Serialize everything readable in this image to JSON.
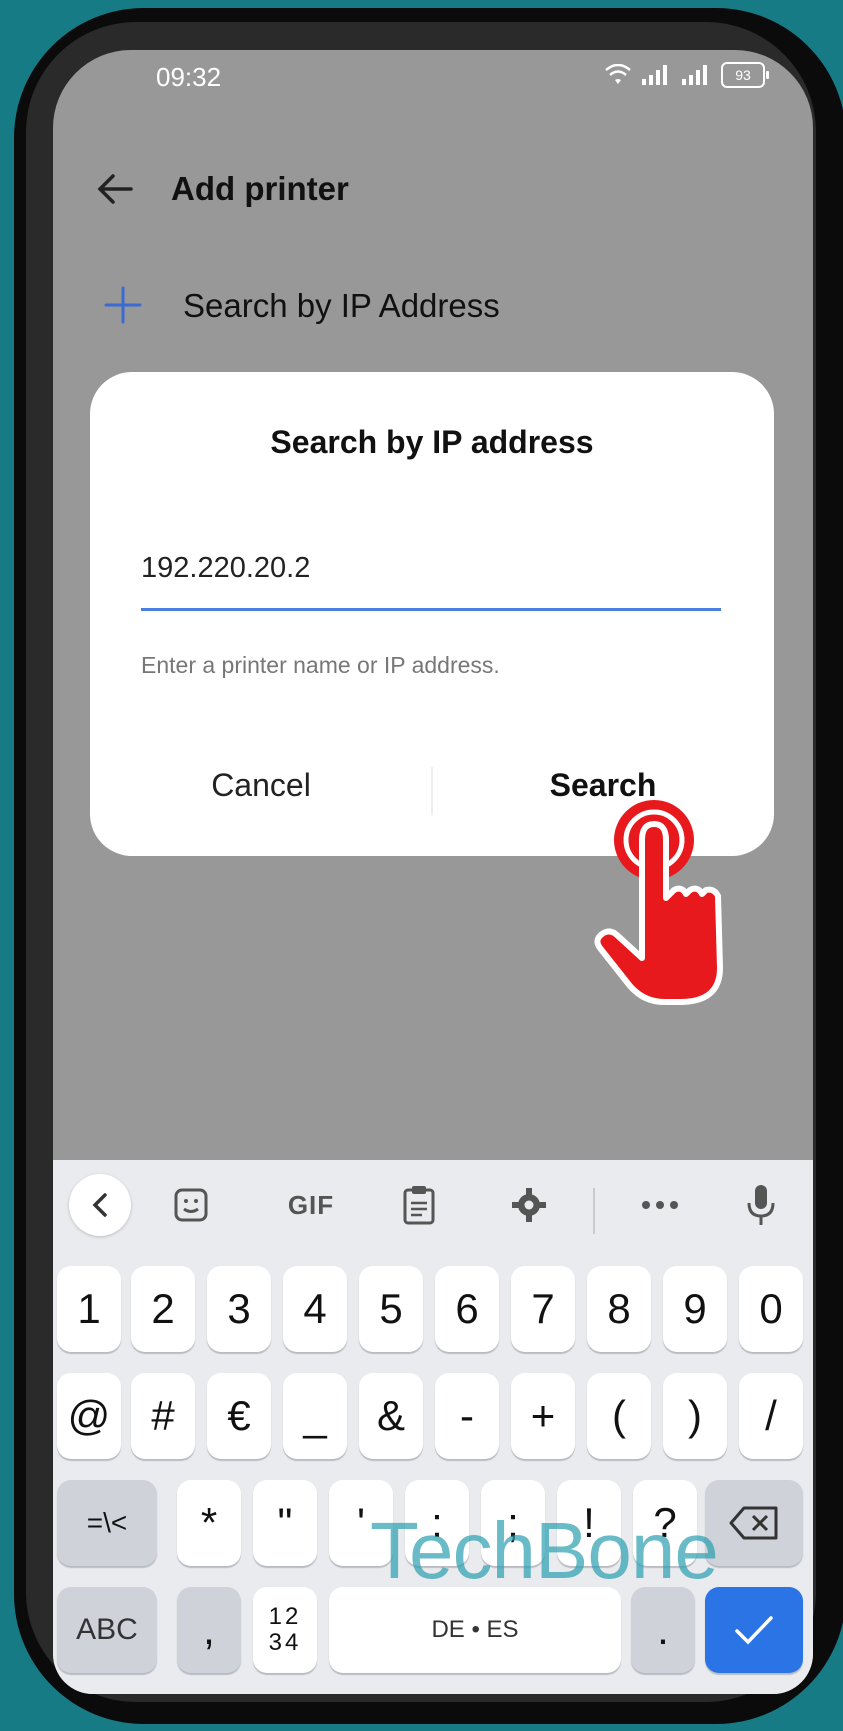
{
  "status_bar": {
    "time": "09:32",
    "battery": "93"
  },
  "app_bar": {
    "title": "Add printer"
  },
  "search_row": {
    "label": "Search by IP Address"
  },
  "dialog": {
    "title": "Search by IP address",
    "input_value": "192.220.20.2",
    "hint": "Enter a printer name or IP address.",
    "cancel_label": "Cancel",
    "search_label": "Search"
  },
  "keyboard": {
    "toolbar": {
      "gif_label": "GIF"
    },
    "row1": [
      "1",
      "2",
      "3",
      "4",
      "5",
      "6",
      "7",
      "8",
      "9",
      "0"
    ],
    "row2": [
      "@",
      "#",
      "€",
      "_",
      "&",
      "-",
      "+",
      "(",
      ")",
      "/"
    ],
    "row3": [
      "=\\<",
      "*",
      "\"",
      "'",
      ":",
      ";",
      "!",
      "?"
    ],
    "abc_label": "ABC",
    "comma_label": ",",
    "numpad_top": "12",
    "numpad_bottom": "34",
    "space_label": "DE • ES",
    "period_label": "."
  },
  "watermark": "TechBone",
  "colors": {
    "background": "#177b86",
    "accent": "#2a74e6",
    "tap_indicator": "#e8191c"
  }
}
